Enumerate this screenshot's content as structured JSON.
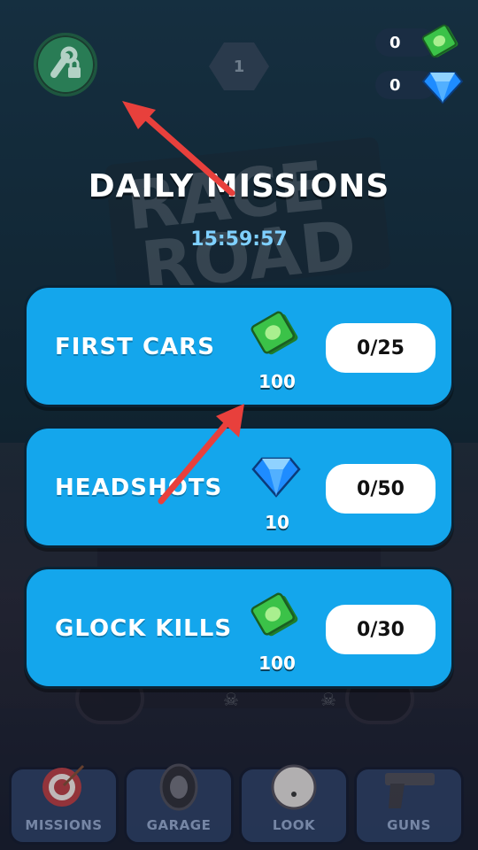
{
  "header": {
    "level": "1",
    "cash_count": "0",
    "gem_count": "0"
  },
  "title": "DAILY MISSIONS",
  "timer": "15:59:57",
  "missions": [
    {
      "name": "FIRST CARS",
      "reward_type": "cash-icon",
      "reward_amount": "100",
      "progress": "0/25"
    },
    {
      "name": "HEADSHOTS",
      "reward_type": "diamond-icon",
      "reward_amount": "10",
      "progress": "0/50"
    },
    {
      "name": "GLOCK KILLS",
      "reward_type": "cash-icon",
      "reward_amount": "100",
      "progress": "0/30"
    }
  ],
  "nav": [
    {
      "label": "MISSIONS",
      "icon": "target-icon"
    },
    {
      "label": "GARAGE",
      "icon": "tire-icon"
    },
    {
      "label": "LOOK",
      "icon": "ball-icon"
    },
    {
      "label": "GUNS",
      "icon": "pistol-icon"
    }
  ],
  "colors": {
    "card": "#14a6ec",
    "cash": "#3bc248",
    "gem": "#1e8cff",
    "timer": "#7fd0ff",
    "arrow": "#e8403c"
  }
}
